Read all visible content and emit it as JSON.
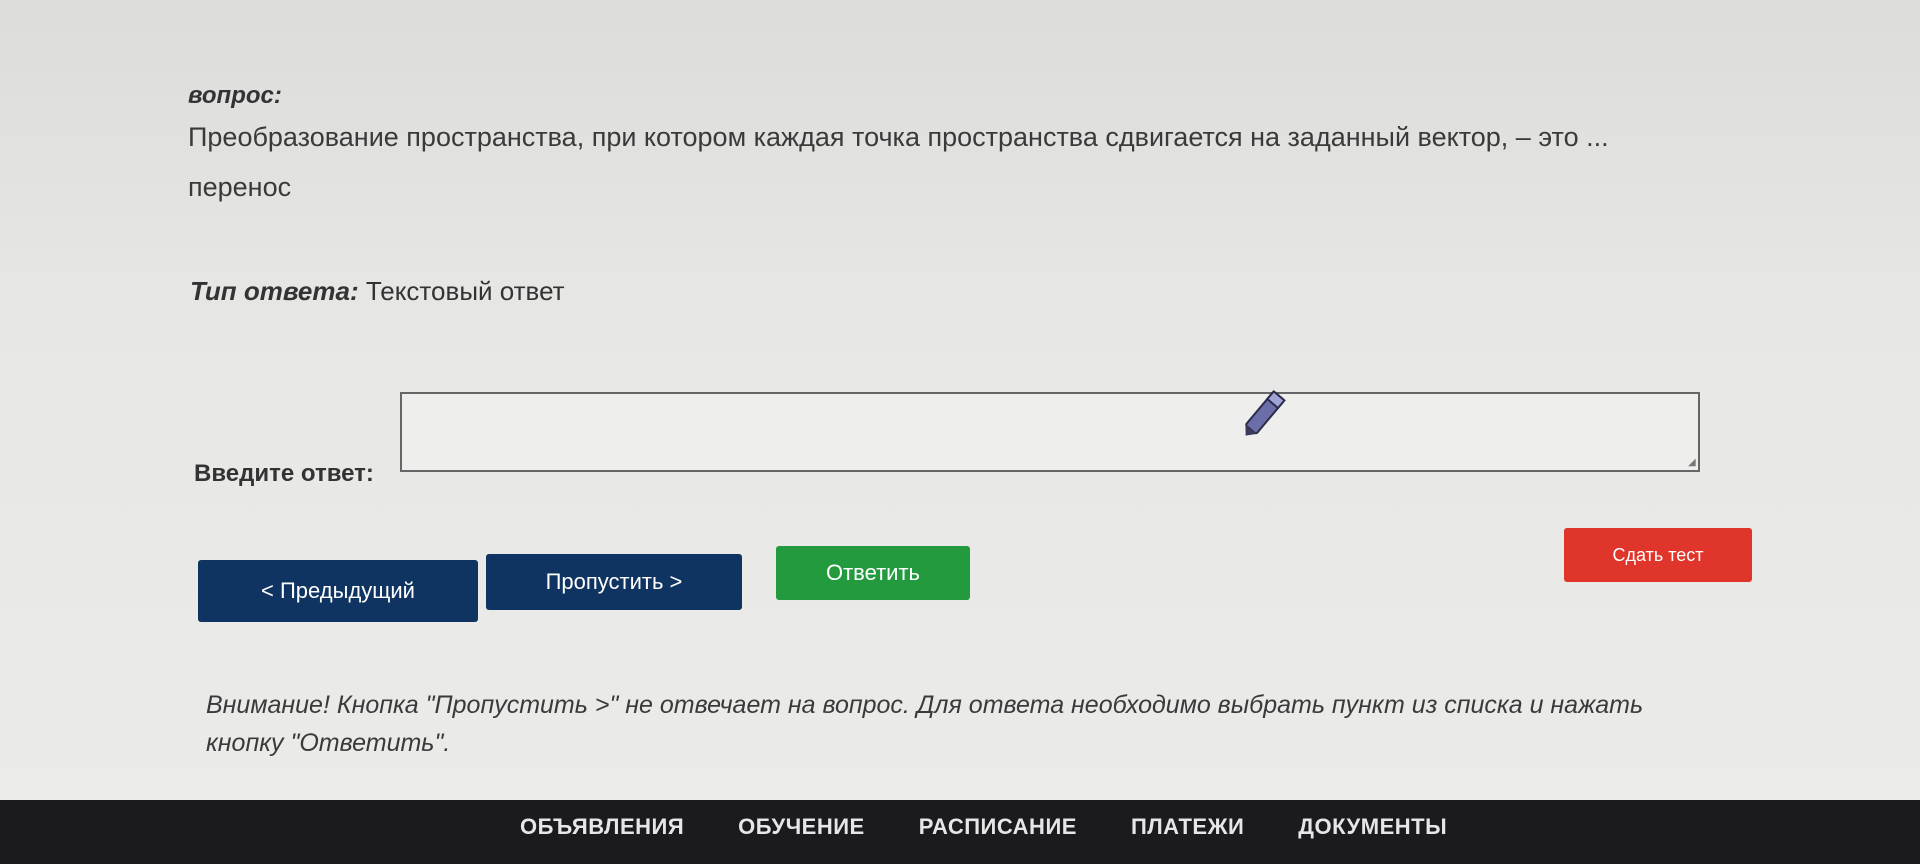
{
  "question": {
    "label": "вопрос:",
    "text": "Преобразование пространства, при котором каждая точка пространства сдвигается на заданный вектор, – это ...",
    "hint": "перенос"
  },
  "answer_type": {
    "label": "Тип ответа:",
    "value": "Текстовый ответ"
  },
  "answer_field": {
    "label": "Введите ответ:",
    "value": ""
  },
  "buttons": {
    "previous": "< Предыдущий",
    "skip": "Пропустить >",
    "answer": "Ответить",
    "submit": "Сдать тест"
  },
  "notice": "Внимание! Кнопка \"Пропустить >\" не отвечает на вопрос. Для ответа необходимо выбрать пункт из списка и нажать кнопку \"Ответить\".",
  "footer_nav": [
    {
      "label": "ОБЪЯВЛЕНИЯ"
    },
    {
      "label": "ОБУЧЕНИЕ"
    },
    {
      "label": "РАСПИСАНИЕ"
    },
    {
      "label": "ПЛАТЕЖИ"
    },
    {
      "label": "ДОКУМЕНТЫ"
    }
  ],
  "colors": {
    "primary_button": "#0f3461",
    "answer_button": "#239a3e",
    "submit_button": "#e0352a",
    "footer": "#1b1b1f"
  },
  "icons": {
    "cursor": "pencil-cursor-icon",
    "resize": "resize-grip-icon"
  }
}
